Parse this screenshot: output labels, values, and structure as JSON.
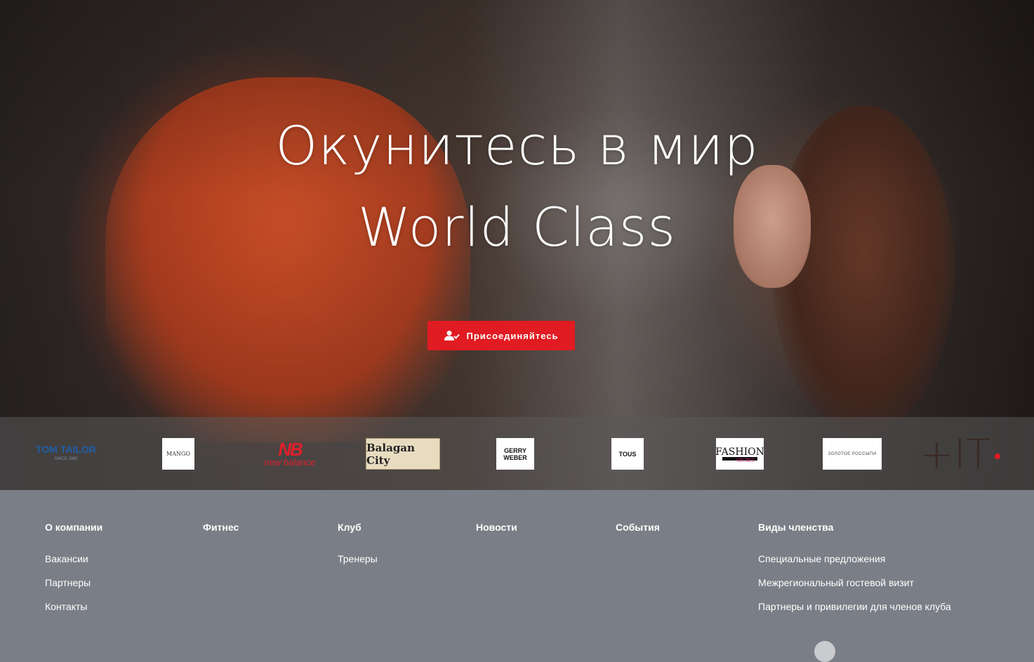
{
  "hero": {
    "title_line1": "Окунитесь в мир",
    "title_line2": "World Class",
    "join_button": "Присоединяйтесь",
    "join_icon": "user-check-icon",
    "accent_color": "#e11b22"
  },
  "brands": {
    "tom_tailor": "TOM TAILOR",
    "tom_tailor_sub": "SINCE 1962",
    "mango": "MANGO",
    "new_balance_mark": "NB",
    "new_balance": "new balance",
    "balagan": "Balagan City",
    "gerry_weber_1": "GERRY",
    "gerry_weber_2": "WEBER",
    "tous": "TOUS",
    "fashion": "FASHION",
    "fashion_sub": "SECRET",
    "zoloto": "ЗОЛОТОЕ РОССЫПИ",
    "plus_it": "+IT"
  },
  "footer": {
    "columns": [
      {
        "heading": "О компании",
        "links": [
          "Вакансии",
          "Партнеры",
          "Контакты"
        ]
      },
      {
        "heading": "Фитнес",
        "links": []
      },
      {
        "heading": "Клуб",
        "links": [
          "Тренеры"
        ]
      },
      {
        "heading": "Новости",
        "links": []
      },
      {
        "heading": "События",
        "links": []
      },
      {
        "heading": "Виды членства",
        "links": [
          "Специальные предложения",
          "Межрегиональный гостевой визит",
          "Партнеры и привилегии для членов клуба"
        ]
      }
    ],
    "background": "#7a7e86"
  }
}
